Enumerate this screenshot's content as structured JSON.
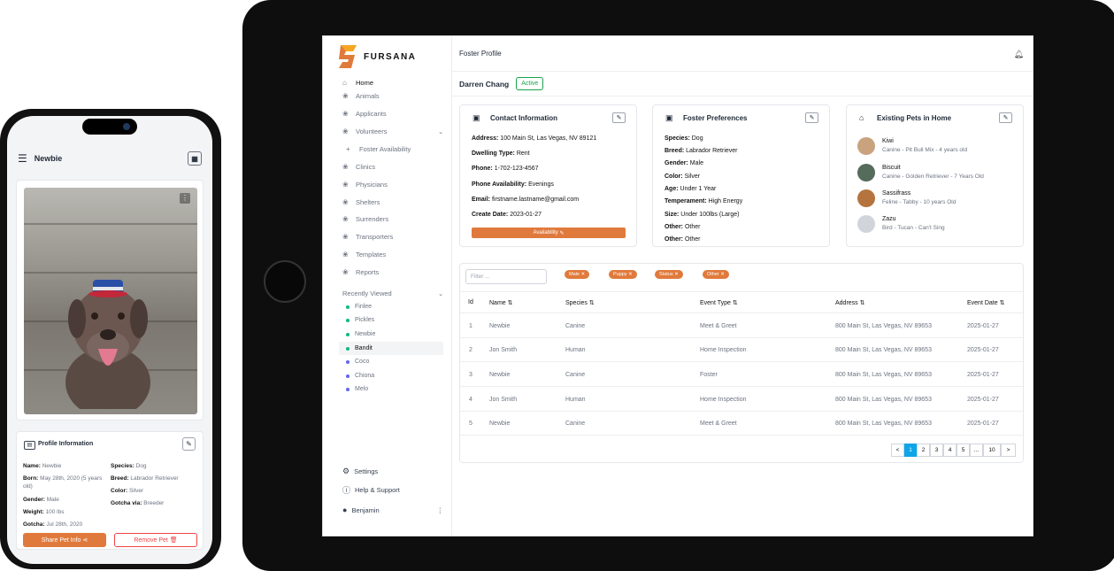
{
  "phone": {
    "title": "Newbie",
    "profile_title": "Profile Information",
    "fields_left": [
      {
        "label": "Name:",
        "value": "Newbie"
      },
      {
        "label": "Born:",
        "value": "May 28th, 2020 (5 years old)"
      },
      {
        "label": "Gender:",
        "value": "Male"
      },
      {
        "label": "Weight:",
        "value": "100 lbs"
      },
      {
        "label": "Gotcha:",
        "value": "Jul 28th, 2020"
      }
    ],
    "fields_right": [
      {
        "label": "Species:",
        "value": "Dog"
      },
      {
        "label": "Breed:",
        "value": "Labrador Retriever"
      },
      {
        "label": "Color:",
        "value": "Silver"
      },
      {
        "label": "Gotcha via:",
        "value": "Breeder"
      }
    ],
    "share_label": "Share Pet Info",
    "remove_label": "Remove Pet"
  },
  "app": {
    "brand": "FURSANA",
    "colors": {
      "accent": "#e07a3c",
      "active": "#16a34a",
      "page_selected": "#0ea5e9"
    },
    "nav": [
      {
        "label": "Home",
        "icon": "home-icon"
      },
      {
        "label": "Animals",
        "icon": "paw-icon"
      },
      {
        "label": "Applicants",
        "icon": "paw-icon"
      },
      {
        "label": "Volunteers",
        "icon": "paw-icon"
      },
      {
        "label": "Foster Availability",
        "icon": "plus-icon"
      },
      {
        "label": "Clinics",
        "icon": "paw-icon"
      },
      {
        "label": "Physicians",
        "icon": "paw-icon"
      },
      {
        "label": "Shelters",
        "icon": "paw-icon"
      },
      {
        "label": "Surrenders",
        "icon": "paw-icon"
      },
      {
        "label": "Transporters",
        "icon": "paw-icon"
      },
      {
        "label": "Templates",
        "icon": "paw-icon"
      },
      {
        "label": "Reports",
        "icon": "paw-icon"
      }
    ],
    "recently_viewed_label": "Recently Viewed",
    "recently_viewed": [
      {
        "label": "Finlee",
        "color": "#10b981"
      },
      {
        "label": "Pickles",
        "color": "#10b981"
      },
      {
        "label": "Newbie",
        "color": "#10b981"
      },
      {
        "label": "Bandit",
        "color": "#10b981"
      },
      {
        "label": "Coco",
        "color": "#6366f1"
      },
      {
        "label": "Chiona",
        "color": "#6366f1"
      },
      {
        "label": "Melo",
        "color": "#6366f1"
      }
    ],
    "settings_label": "Settings",
    "help_label": "Help & Support",
    "user_name": "Benjamin",
    "page_title": "Foster Profile",
    "foster_name": "Darren Chang",
    "status": "Active",
    "contact": {
      "title": "Contact Information",
      "lines": [
        {
          "label": "Address:",
          "value": "100 Main St, Las Vegas, NV 89121"
        },
        {
          "label": "Dwelling Type:",
          "value": "Rent"
        },
        {
          "label": "Phone:",
          "value": "1-702-123-4567"
        },
        {
          "label": "Phone Availability:",
          "value": "Evenings"
        },
        {
          "label": "Email:",
          "value": "firstname.lastname@gmail.com"
        },
        {
          "label": "Create Date:",
          "value": "2023-01-27"
        }
      ],
      "availability_label": "Availability"
    },
    "preferences": {
      "title": "Foster Preferences",
      "lines": [
        {
          "label": "Species:",
          "value": "Dog"
        },
        {
          "label": "Breed:",
          "value": "Labrador Retriever"
        },
        {
          "label": "Gender:",
          "value": "Male"
        },
        {
          "label": "Color:",
          "value": "Silver"
        },
        {
          "label": "Age:",
          "value": "Under 1 Year"
        },
        {
          "label": "Temperament:",
          "value": "High Energy"
        },
        {
          "label": "Size:",
          "value": "Under 100lbs (Large)"
        },
        {
          "label": "Other:",
          "value": "Other"
        },
        {
          "label": "Other:",
          "value": "Other"
        }
      ]
    },
    "pets": {
      "title": "Existing Pets in Home",
      "items": [
        {
          "name": "Kiwi",
          "desc": "Canine - Pit Bull Mix - 4 years old",
          "color": "#c9a27e"
        },
        {
          "name": "Biscuit",
          "desc": "Canine - Golden Retriever - 7 Years Old",
          "color": "#556b5b"
        },
        {
          "name": "Sassifrass",
          "desc": "Feline - Tabby - 10 years Old",
          "color": "#b5743e"
        },
        {
          "name": "Zazu",
          "desc": "Bird - Tucan - Can't Sing",
          "color": "#d1d5db"
        }
      ]
    },
    "filter_placeholder": "Filter ...",
    "chips": [
      "Male",
      "Puppy",
      "Status",
      "Other"
    ],
    "columns": [
      "Id",
      "Name",
      "Species",
      "Event Type",
      "Address",
      "Event Date"
    ],
    "rows": [
      [
        "1",
        "Newbie",
        "Canine",
        "Meet & Greet",
        "800 Main St, Las Vegas, NV 89653",
        "2025-01-27"
      ],
      [
        "2",
        "Jon Smith",
        "Human",
        "Home Inspection",
        "800 Main St, Las Vegas, NV 89653",
        "2025-01-27"
      ],
      [
        "3",
        "Newbie",
        "Canine",
        "Foster",
        "800 Main St, Las Vegas, NV 89653",
        "2025-01-27"
      ],
      [
        "4",
        "Jon Smith",
        "Human",
        "Home Inspection",
        "800 Main St, Las Vegas, NV 89653",
        "2025-01-27"
      ],
      [
        "5",
        "Newbie",
        "Canine",
        "Meet & Greet",
        "800 Main St, Las Vegas, NV 89653",
        "2025-01-27"
      ]
    ],
    "pagination": [
      "<",
      "1",
      "2",
      "3",
      "4",
      "5",
      "...",
      "10",
      ">"
    ]
  }
}
